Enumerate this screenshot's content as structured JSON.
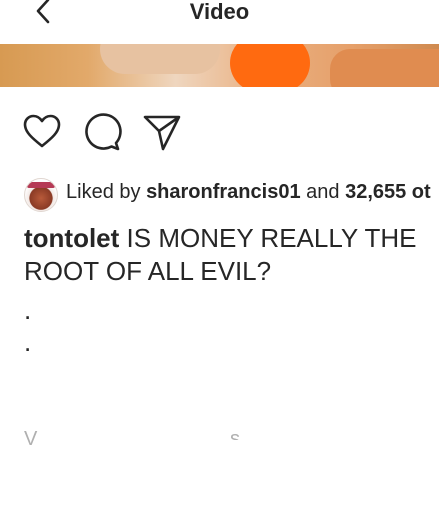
{
  "header": {
    "title": "Video",
    "back_icon": "chevron-left-icon"
  },
  "video": {
    "accent_color": "#ff6a10"
  },
  "actions": {
    "like_icon": "heart-icon",
    "comment_icon": "comment-icon",
    "share_icon": "send-icon"
  },
  "likes": {
    "prefix": "Liked by",
    "user": "sharonfrancis01",
    "and": "and",
    "count_text": "32,655 ot"
  },
  "post": {
    "username": "tontolet",
    "caption": "IS MONEY REALLY THE ROOT OF ALL EVIL?",
    "dot1": ".",
    "dot2": ".",
    "partial_view": "V",
    "partial_tail": "s"
  },
  "colors": {
    "text": "#262626",
    "divider": "#dbdbdb"
  }
}
